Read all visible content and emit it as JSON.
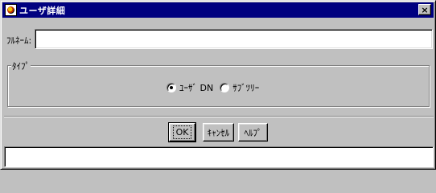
{
  "window": {
    "title": "ユーザ詳細",
    "close_label": "×"
  },
  "form": {
    "fullname_label": "ﾌﾙﾈｰﾑ:",
    "fullname_value": "",
    "type_group_label": "ﾀｲﾌﾟ",
    "type_options": [
      {
        "label": "ﾕｰｻﾞ DN",
        "selected": true
      },
      {
        "label": "ｻﾌﾞﾂﾘｰ",
        "selected": false
      }
    ]
  },
  "buttons": {
    "ok": "OK",
    "cancel": "ｷｬﾝｾﾙ",
    "help": "ﾍﾙﾌﾟ"
  },
  "status": {
    "text": ""
  },
  "colors": {
    "title_bar": "#000080",
    "face": "#c0c0c0"
  },
  "icons": {
    "app": "app-icon",
    "close": "close-icon"
  }
}
